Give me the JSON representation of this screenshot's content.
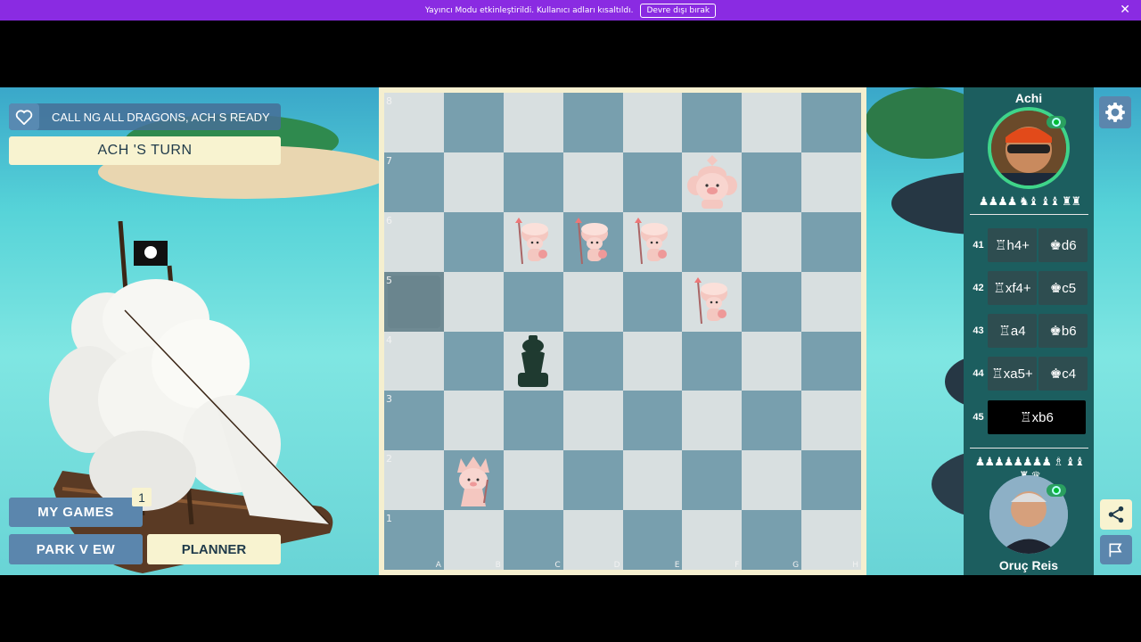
{
  "banner": {
    "text": "Yayıncı Modu etkinleştirildi. Kullanıcı adları kısaltıldı.",
    "button": "Devre dışı bırak",
    "close": "✕"
  },
  "game": {
    "status": "CALL NG ALL DRAGONS, ACH  S READY",
    "turn": "ACH 'S TURN"
  },
  "nav": {
    "my_games": "MY GAMES",
    "my_games_badge": "1",
    "park_view": "PARK V EW",
    "planner": "PLANNER"
  },
  "board": {
    "ranks": [
      "8",
      "7",
      "6",
      "5",
      "4",
      "3",
      "2",
      "1"
    ],
    "files": [
      "A",
      "B",
      "C",
      "D",
      "E",
      "F",
      "G",
      "H"
    ]
  },
  "players": {
    "top": {
      "name": "Achi",
      "captured": "♟♟♟♟ ♞♝ ♝♝ ♜♜"
    },
    "bottom": {
      "name": "Oruç Reis",
      "captured": "♟♟♟♟♟♟♟♟ ♗ ♝♝ ♜ ♛"
    }
  },
  "moves": [
    {
      "num": "41",
      "white": "♖h4+",
      "black": "♚d6"
    },
    {
      "num": "42",
      "white": "♖xf4+",
      "black": "♚c5"
    },
    {
      "num": "43",
      "white": "♖a4",
      "black": "♚b6"
    },
    {
      "num": "44",
      "white": "♖xa5+",
      "black": "♚c4"
    },
    {
      "num": "45",
      "white": "♖xb6",
      "black": ""
    }
  ],
  "colors": {
    "banner": "#8a2be2",
    "board_light": "#d8dfe0",
    "board_dark": "#789fae",
    "panel": "#1c5e5f",
    "avatar_ring": "#3fd48a"
  },
  "icons": {
    "settings": "gear-icon",
    "share": "share-icon",
    "flag": "flag-icon",
    "heart": "heart-icon"
  }
}
